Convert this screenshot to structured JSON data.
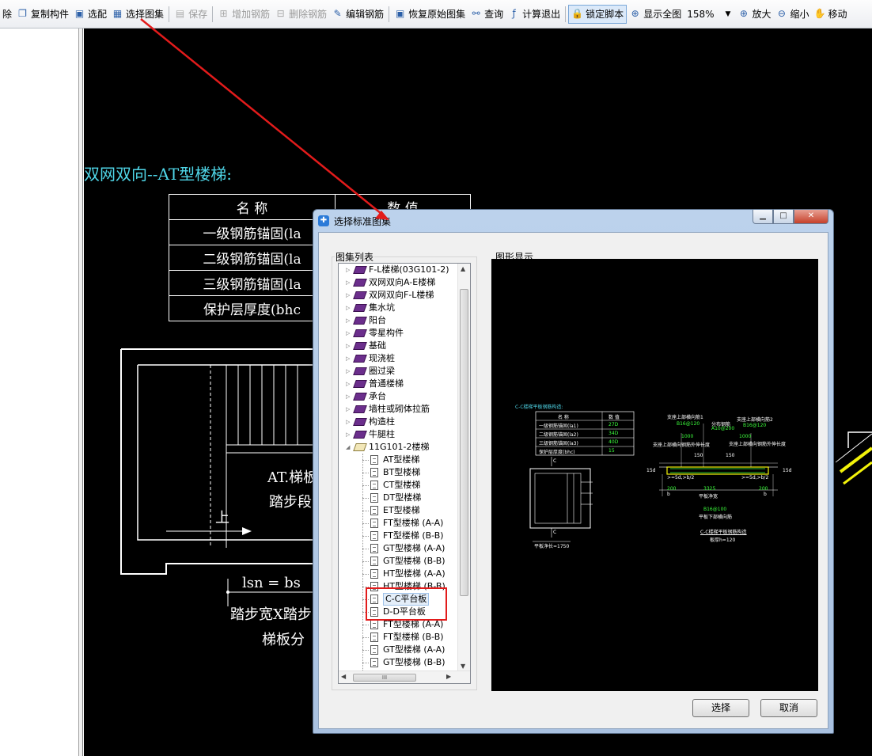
{
  "toolbar": {
    "items": [
      {
        "label": "除",
        "icon": "delete-icon",
        "disabled": false
      },
      {
        "label": "复制构件",
        "icon": "copy-icon",
        "disabled": false
      },
      {
        "label": "选配",
        "icon": "select-match-icon",
        "disabled": false
      },
      {
        "label": "选择图集",
        "icon": "atlas-icon",
        "disabled": false
      },
      {
        "label": "保存",
        "icon": "save-icon",
        "disabled": true
      },
      {
        "label": "增加钢筋",
        "icon": "add-rebar-icon",
        "disabled": true
      },
      {
        "label": "删除钢筋",
        "icon": "delete-rebar-icon",
        "disabled": true
      },
      {
        "label": "编辑钢筋",
        "icon": "edit-rebar-icon",
        "disabled": false
      },
      {
        "label": "恢复原始图集",
        "icon": "restore-icon",
        "disabled": false
      },
      {
        "label": "查询",
        "icon": "binoculars-icon",
        "disabled": false
      },
      {
        "label": "计算退出",
        "icon": "fx-icon",
        "disabled": false
      },
      {
        "label": "锁定脚本",
        "icon": "lock-icon",
        "disabled": false
      },
      {
        "label": "显示全图",
        "icon": "zoom-all-icon",
        "disabled": false
      }
    ],
    "zoom_value": "158%",
    "zoom_in": "放大",
    "zoom_out": "缩小",
    "move": "移动"
  },
  "canvas": {
    "title": "双网双向--AT型楼梯:",
    "table_header": [
      "名 称",
      "数 值"
    ],
    "table_rows": [
      "一级钢筋锚固(la",
      "二级钢筋锚固(la",
      "三级钢筋锚固(la",
      "保护层厚度(bhc"
    ],
    "drawing_texts": {
      "at_label": "AT.梯板",
      "step_label": "踏步段",
      "up_label": "上",
      "lsn": "lsn = bs",
      "step_width": "踏步宽X踏步",
      "plate_div": "梯板分"
    }
  },
  "dialog": {
    "title": "选择标准图集",
    "atlas_list_label": "图集列表",
    "graphic_label": "图形显示",
    "tree": [
      {
        "level": 1,
        "label": "F-L楼梯(03G101-2)",
        "expanded": false
      },
      {
        "level": 1,
        "label": "双网双向A-E楼梯",
        "expanded": false
      },
      {
        "level": 1,
        "label": "双网双向F-L楼梯",
        "expanded": false
      },
      {
        "level": 1,
        "label": "集水坑",
        "expanded": false
      },
      {
        "level": 1,
        "label": "阳台",
        "expanded": false
      },
      {
        "level": 1,
        "label": "零星构件",
        "expanded": false
      },
      {
        "level": 1,
        "label": "基础",
        "expanded": false
      },
      {
        "level": 1,
        "label": "现浇桩",
        "expanded": false
      },
      {
        "level": 1,
        "label": "圈过梁",
        "expanded": false
      },
      {
        "level": 1,
        "label": "普通楼梯",
        "expanded": false
      },
      {
        "level": 1,
        "label": "承台",
        "expanded": false
      },
      {
        "level": 1,
        "label": "墙柱或砌体拉筋",
        "expanded": false
      },
      {
        "level": 1,
        "label": "构造柱",
        "expanded": false
      },
      {
        "level": 1,
        "label": "牛腿柱",
        "expanded": false
      },
      {
        "level": 1,
        "label": "11G101-2楼梯",
        "expanded": true
      },
      {
        "level": 2,
        "label": "AT型楼梯"
      },
      {
        "level": 2,
        "label": "BT型楼梯"
      },
      {
        "level": 2,
        "label": "CT型楼梯"
      },
      {
        "level": 2,
        "label": "DT型楼梯"
      },
      {
        "level": 2,
        "label": "ET型楼梯"
      },
      {
        "level": 2,
        "label": "FT型楼梯 (A-A)"
      },
      {
        "level": 2,
        "label": "FT型楼梯 (B-B)"
      },
      {
        "level": 2,
        "label": "GT型楼梯 (A-A)"
      },
      {
        "level": 2,
        "label": "GT型楼梯 (B-B)"
      },
      {
        "level": 2,
        "label": "HT型楼梯 (A-A)"
      },
      {
        "level": 2,
        "label": "HT型楼梯 (B-B)"
      },
      {
        "level": 2,
        "label": "C-C平台板",
        "selected": true
      },
      {
        "level": 2,
        "label": "D-D平台板"
      },
      {
        "level": 2,
        "label": "FT型楼梯 (A-A)"
      },
      {
        "level": 2,
        "label": "FT型楼梯 (B-B)"
      },
      {
        "level": 2,
        "label": "GT型楼梯 (A-A)"
      },
      {
        "level": 2,
        "label": "GT型楼梯 (B-B)"
      }
    ],
    "hscroll_grip": "III",
    "select_button": "选择",
    "cancel_button": "取消",
    "preview": {
      "title": "C-C楼梯平板钢筋构造:",
      "table_header": [
        "名 称",
        "数 值"
      ],
      "table_rows": [
        [
          "一级钢筋锚固(la1)",
          "27D"
        ],
        [
          "二级钢筋锚固(la2)",
          "34D"
        ],
        [
          "三级钢筋锚固(la3)",
          "40D"
        ],
        [
          "保护层厚度(bhc)",
          "15"
        ]
      ],
      "labels": {
        "support_top1": "支座上部横向筋1",
        "support_top2": "支座上部横向筋2",
        "dist_bar": "分布钢筋",
        "b1": "B16@120",
        "a1": "A10@200",
        "b2": "B16@120",
        "dim1": "1000",
        "dim2": "1000",
        "left_note": "支座上部横向钢筋外伸长度",
        "right_note": "支座上部横向钢筋外伸长度",
        "n150a": "150",
        "n150b": "150",
        "ge5d": ">=5d,>b/2",
        "ge5d2": ">=5d,>b/2",
        "span": "3325",
        "net_span": "平板净宽",
        "bottom_bar": "B16@100",
        "bottom_note": "平板下部横向筋",
        "section_note": "C-C楼梯平板钢筋构造",
        "thickness": "板厚h=120",
        "n200a": "200",
        "n200b": "200",
        "left_len": "平板净长=1750",
        "c_top": "C",
        "c_bottom": "C",
        "b_left": "b",
        "b_right": "b",
        "n15a": "15d",
        "n15b": "15d"
      }
    }
  },
  "colors": {
    "cad_cyan": "#4fd6e8",
    "highlight": "#e21b1b",
    "arrow": "#e21b1b",
    "preview_green": "#3cff3c",
    "preview_yellow": "#f2f20a"
  }
}
